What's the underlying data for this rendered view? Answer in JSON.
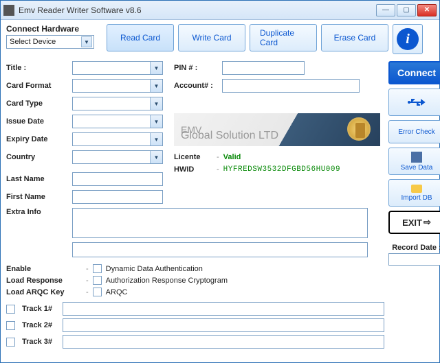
{
  "window": {
    "title": "Emv Reader Writer Software v8.6"
  },
  "connect": {
    "label": "Connect Hardware",
    "device": "Select Device"
  },
  "topbuttons": {
    "read": "Read Card",
    "write": "Write Card",
    "duplicate": "Duplicate Card",
    "erase": "Erase Card"
  },
  "labels": {
    "title": "Title :",
    "pin": "PIN # :",
    "cardformat": "Card Format",
    "account": "Account# :",
    "cardtype": "Card Type",
    "issuedate": "Issue Date",
    "expirydate": "Expiry Date",
    "country": "Country",
    "lastname": "Last Name",
    "firstname": "First Name",
    "extrainfo": "Extra Info"
  },
  "banner": {
    "line1": "EMV",
    "line2": "Global Solution LTD"
  },
  "status": {
    "license_label": "Licente",
    "license_value": "Valid",
    "hwid_label": "HWID",
    "hwid_value": "HYFREDSW3532DFGBD56HU009"
  },
  "side": {
    "connect": "Connect",
    "errorcheck": "Error Check",
    "savedata": "Save Data",
    "importdb": "Import DB",
    "exit": "EXIT",
    "recorddate": "Record Date :"
  },
  "checks": {
    "enable": "Enable",
    "loadresponse": "Load Response",
    "loadarqc": "Load ARQC Key",
    "dda": "Dynamic Data Authentication",
    "arc": "Authorization Response Cryptogram",
    "arqc": "ARQC"
  },
  "tracks": {
    "t1": "Track 1#",
    "t2": "Track 2#",
    "t3": "Track 3#"
  }
}
